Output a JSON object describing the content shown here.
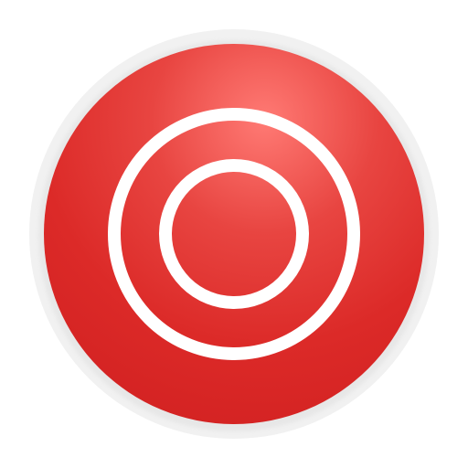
{
  "icon": {
    "name": "target-rings-icon",
    "colors": {
      "base_red": "#dc2626",
      "dark_red": "#d32222",
      "highlight_red": "#ff7a74",
      "ring_white": "#ffffff",
      "rim": "#f1f1f1"
    }
  }
}
